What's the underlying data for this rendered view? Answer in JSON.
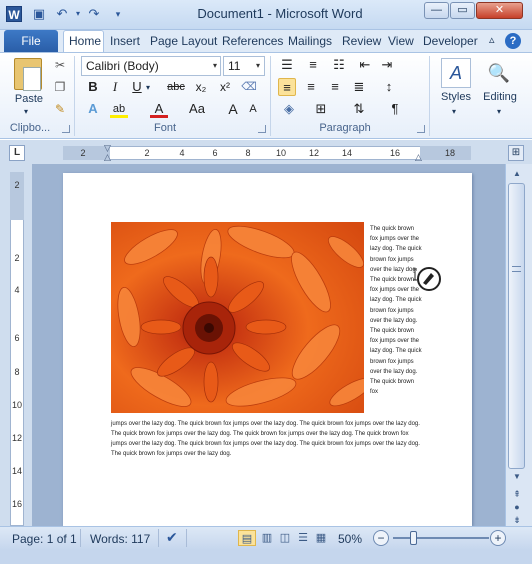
{
  "window": {
    "title": "Document1  -  Microsoft Word",
    "app_icon_letter": "W",
    "minimize": "—",
    "maximize": "▭",
    "close": "✕"
  },
  "tabs": [
    "File",
    "Home",
    "Insert",
    "Page Layout",
    "References",
    "Mailings",
    "Review",
    "View",
    "Developer"
  ],
  "ribbon": {
    "clipboard": {
      "label": "Clipbo...",
      "paste": "Paste"
    },
    "font": {
      "label": "Font",
      "family": "Calibri (Body)",
      "size": "11",
      "bold": "B",
      "italic": "I",
      "underline": "U",
      "strike": "abc",
      "subscript": "x₂",
      "superscript": "x²",
      "font_color": "A",
      "change_case": "Aa",
      "grow": "A",
      "shrink": "A"
    },
    "paragraph": {
      "label": "Paragraph"
    },
    "styles": {
      "label": "Styles"
    },
    "editing": {
      "label": "Editing"
    }
  },
  "ruler": {
    "corner": "L",
    "hticks": [
      "2",
      "2",
      "4",
      "6",
      "8",
      "10",
      "12",
      "14",
      "16",
      "18"
    ],
    "vticks": [
      "2",
      "2",
      "4",
      "6",
      "8",
      "10",
      "12",
      "14",
      "16"
    ]
  },
  "document": {
    "wrap_text": "The quick brown fox jumps over the lazy dog. The quick brown fox jumps over the lazy dog. The quick brown fox jumps over the lazy dog. The quick brown fox jumps over the lazy dog. The quick brown fox jumps over the lazy dog. The quick brown fox jumps over the lazy dog. The quick brown fox",
    "body_text": "jumps over the lazy dog. The quick brown fox jumps over the lazy dog. The quick brown fox jumps over the lazy dog. The quick brown fox jumps over the lazy dog. The quick brown fox jumps over the lazy dog. The quick brown fox jumps over the lazy dog. The quick brown fox jumps over the lazy dog. The quick brown fox jumps over the lazy dog. The quick brown fox jumps over the lazy dog."
  },
  "status": {
    "page": "Page: 1 of 1",
    "words": "Words: 117",
    "zoom": "50%"
  },
  "colors": {
    "accent": "#2b579a",
    "file_tab": "#2a5ea8",
    "image_primary": "#e8501a"
  }
}
